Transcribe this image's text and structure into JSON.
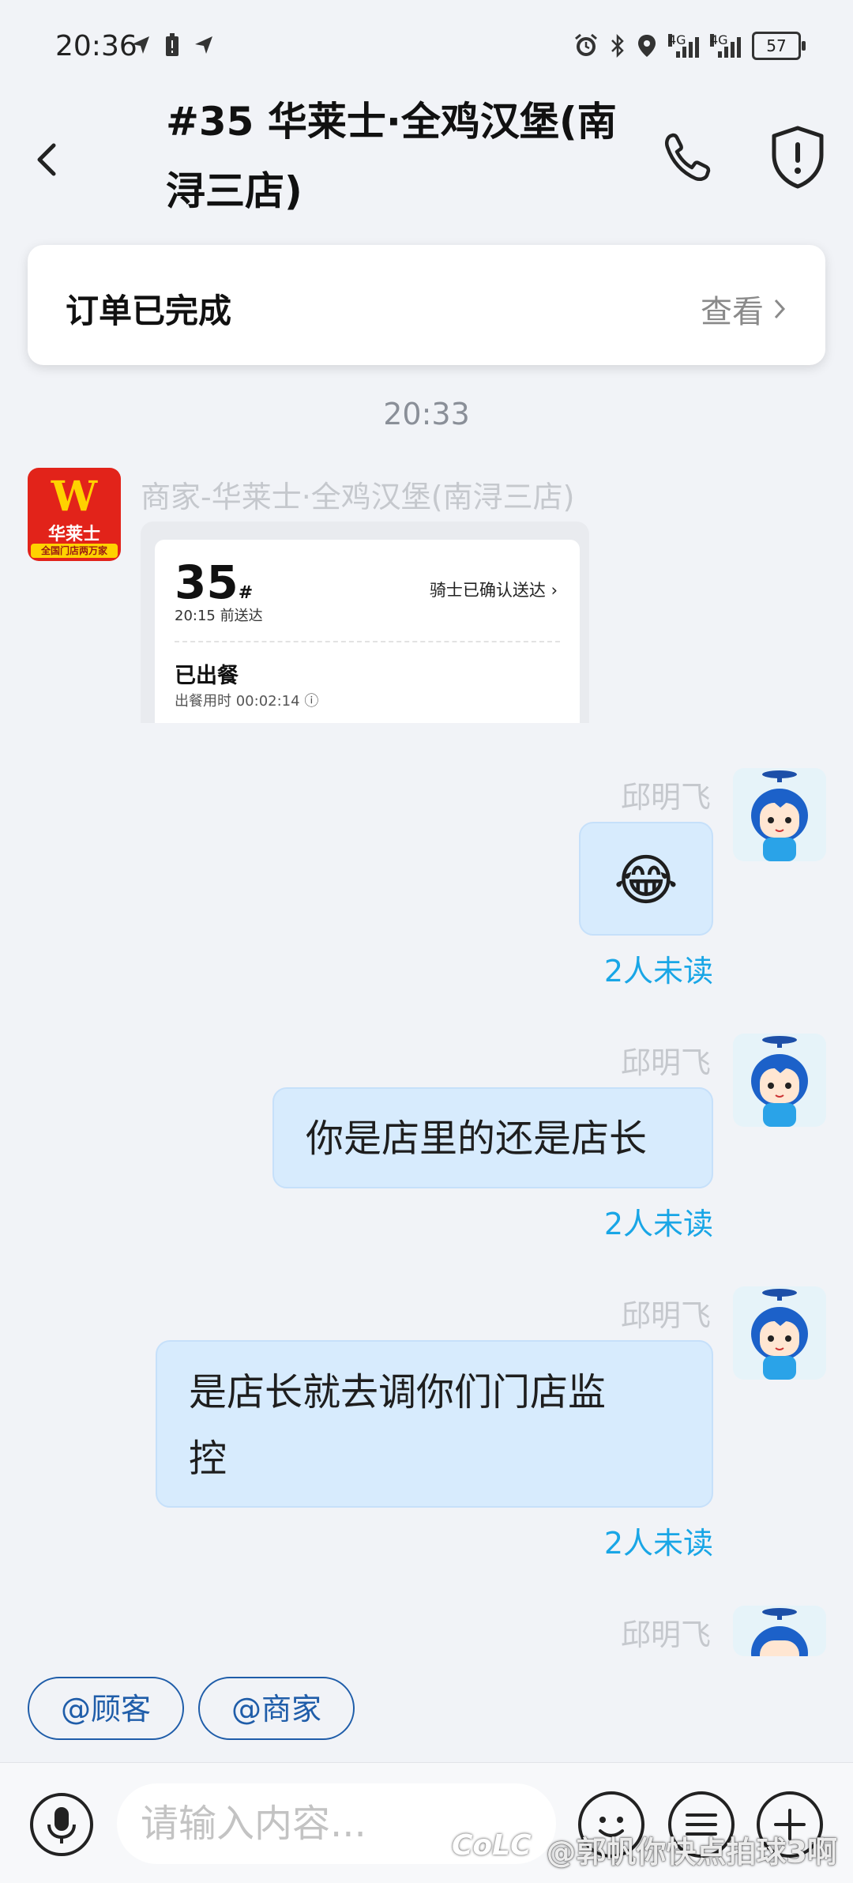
{
  "status_bar": {
    "time": "20:36",
    "network_1": "4G",
    "network_2": "4G",
    "battery": "57"
  },
  "header": {
    "title": "#35 华莱士·全鸡汉堡(南浔三店)"
  },
  "order_card": {
    "status": "订单已完成",
    "view_label": "查看"
  },
  "timestamp": "20:33",
  "merchant_message": {
    "sender": "商家-华莱士·全鸡汉堡(南浔三店)",
    "avatar": {
      "logo_letter": "W",
      "brand": "华莱士",
      "slogan": "全国门店两万家"
    },
    "card": {
      "order_number": "35",
      "order_suffix": "#",
      "deliver_time": "20:15 前送达",
      "rider_status": "骑士已确认送达",
      "meal_state": "已出餐",
      "meal_duration": "出餐用时 00:02:14"
    }
  },
  "messages": [
    {
      "sender": "邱明飞",
      "text": "😂",
      "unread": "2人未读"
    },
    {
      "sender": "邱明飞",
      "text": "你是店里的还是店长",
      "unread": "2人未读"
    },
    {
      "sender": "邱明飞",
      "text_line1": "是店长就去调你们门店监",
      "text_line2": "控",
      "unread": "2人未读"
    },
    {
      "sender": "邱明飞"
    }
  ],
  "mention_chips": [
    "@顾客",
    "@商家"
  ],
  "input": {
    "placeholder": "请输入内容..."
  },
  "watermark": {
    "logo": "CoLC",
    "text": "@郭帆你快点拍球3啊"
  },
  "colors": {
    "accent_blue": "#19a6e6",
    "bubble": "#d7ebfd",
    "chip_border": "#1f5da9",
    "merchant_red": "#e2231a"
  }
}
